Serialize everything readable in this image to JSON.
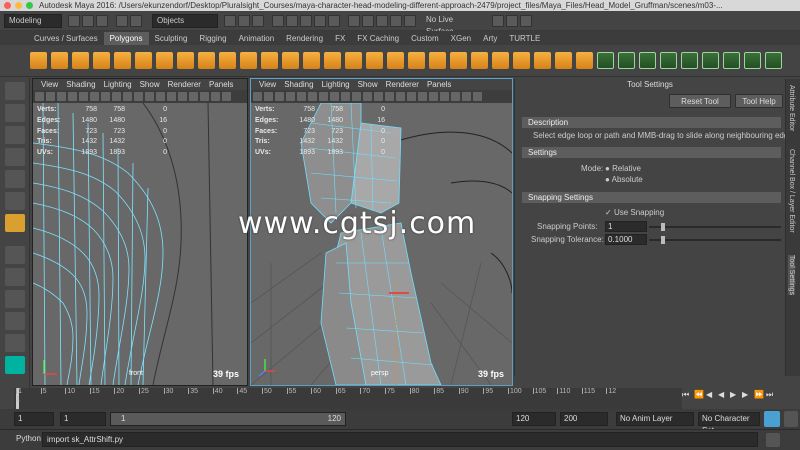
{
  "window": {
    "title": "Autodesk Maya 2016: /Users/ekunzendorf/Desktop/Pluralsight_Courses/maya-character-head-modeling-different-approach-2479/project_files/Maya_Files/Head_Model_Gruffman/scenes/m03-..."
  },
  "statusline": {
    "menuset": "Modeling",
    "selection_mode": "Objects",
    "live_surface": "No Live Surface"
  },
  "shelf_tabs": [
    "Curves / Surfaces",
    "Polygons",
    "Sculpting",
    "Rigging",
    "Animation",
    "Rendering",
    "FX",
    "FX Caching",
    "Custom",
    "XGen",
    "Arty",
    "TURTLE"
  ],
  "active_shelf_tab": "Polygons",
  "panel_menu": [
    "View",
    "Shading",
    "Lighting",
    "Show",
    "Renderer",
    "Panels"
  ],
  "hud": {
    "labels": [
      "Verts:",
      "Edges:",
      "Faces:",
      "Tris:",
      "UVs:"
    ],
    "rows": [
      [
        "758",
        "758",
        "0"
      ],
      [
        "1480",
        "1480",
        "16"
      ],
      [
        "723",
        "723",
        "0"
      ],
      [
        "1432",
        "1432",
        "0"
      ],
      [
        "1893",
        "1893",
        "0"
      ]
    ]
  },
  "viewports": [
    {
      "camera": "front",
      "fps": "39 fps"
    },
    {
      "camera": "persp",
      "fps": "39 fps"
    }
  ],
  "tool_settings": {
    "title": "Tool Settings",
    "reset_label": "Reset Tool",
    "help_label": "Tool Help",
    "description_header": "Description",
    "description": "Select edge loop or path and MMB-drag to slide along neighbouring edges",
    "settings_header": "Settings",
    "mode_label": "Mode:",
    "mode_options": [
      "Relative",
      "Absolute"
    ],
    "mode_selected": "Relative",
    "snapping_header": "Snapping Settings",
    "use_snapping_label": "Use Snapping",
    "use_snapping": true,
    "snapping_points_label": "Snapping Points:",
    "snapping_points": "1",
    "snapping_tolerance_label": "Snapping Tolerance:",
    "snapping_tolerance": "0.1000"
  },
  "side_tabs": [
    "Attribute Editor",
    "Channel Box / Layer Editor",
    "Tool Settings"
  ],
  "timeline": {
    "ticks": [
      "1",
      "5",
      "10",
      "15",
      "20",
      "25",
      "30",
      "35",
      "40",
      "45",
      "50",
      "55",
      "60",
      "65",
      "70",
      "75",
      "80",
      "85",
      "90",
      "95",
      "100",
      "105",
      "110",
      "115",
      "12"
    ],
    "current_frame": "1"
  },
  "range": {
    "start": "1",
    "current": "1",
    "range_start": "1",
    "range_end": "120",
    "end": "120",
    "max": "200",
    "anim_layer": "No Anim Layer",
    "char_set": "No Character Set"
  },
  "cmdline": {
    "lang": "Python",
    "command": "import sk_AttrShift.py"
  },
  "watermark": "www.cgtsj.com"
}
